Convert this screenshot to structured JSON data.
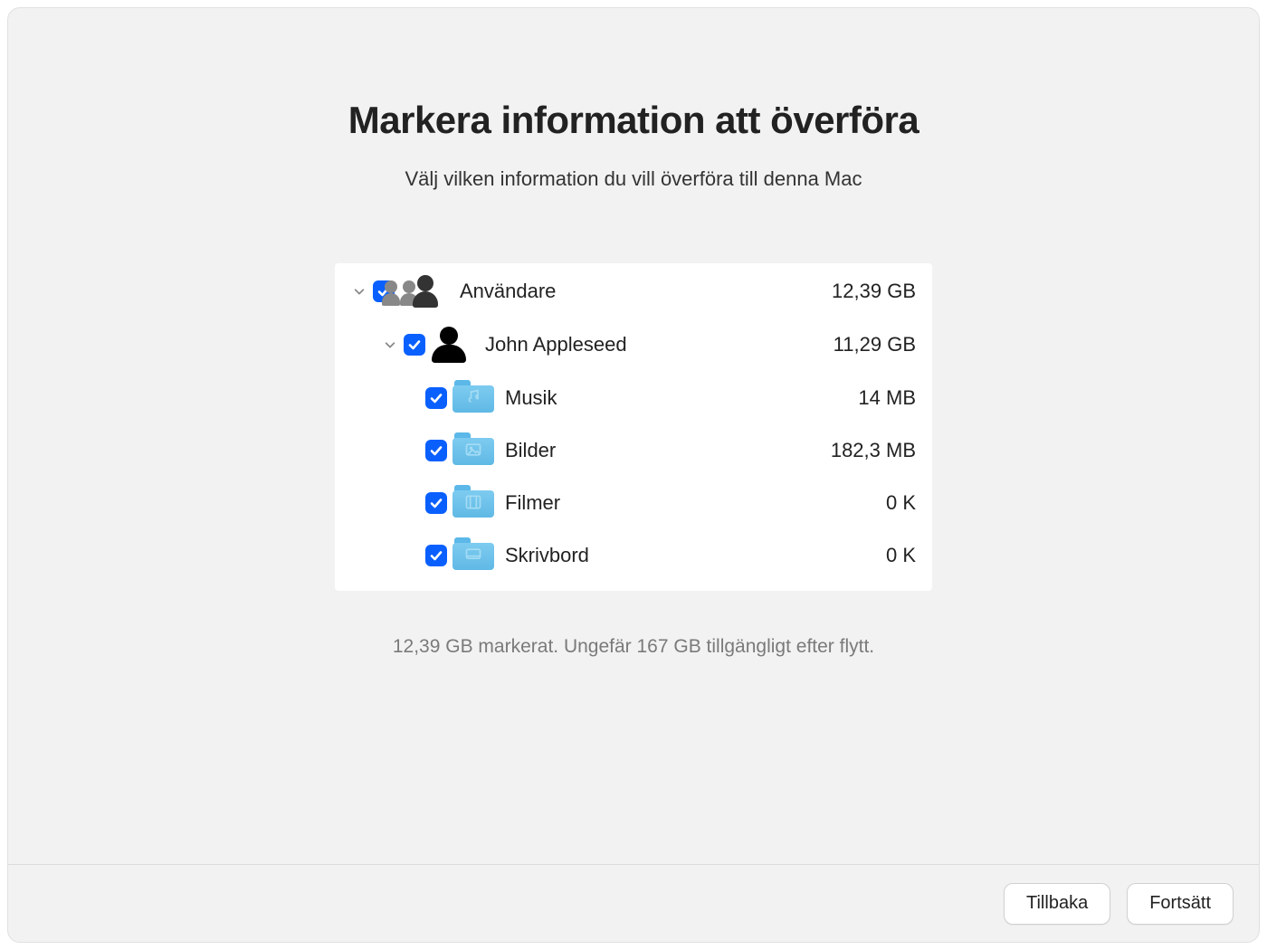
{
  "title": "Markera information att överföra",
  "subtitle": "Välj vilken information du vill överföra till denna Mac",
  "tree": {
    "users": {
      "label": "Användare",
      "size": "12,39 GB"
    },
    "john": {
      "label": "John Appleseed",
      "size": "11,29 GB"
    },
    "music": {
      "label": "Musik",
      "size": "14 MB"
    },
    "pictures": {
      "label": "Bilder",
      "size": "182,3 MB"
    },
    "movies": {
      "label": "Filmer",
      "size": "0 K"
    },
    "desktop": {
      "label": "Skrivbord",
      "size": "0 K"
    }
  },
  "status": "12,39 GB markerat. Ungefär 167 GB tillgängligt efter flytt.",
  "buttons": {
    "back": "Tillbaka",
    "continue": "Fortsätt"
  },
  "colors": {
    "accent": "#0a60ff",
    "folder": "#6bc1ea"
  }
}
